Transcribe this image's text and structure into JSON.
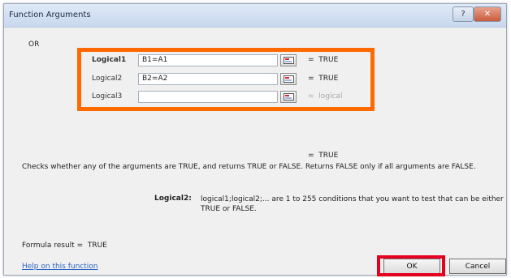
{
  "window": {
    "title": "Function Arguments"
  },
  "function_name": "OR",
  "args": [
    {
      "label": "Logical1",
      "value": "B1=A1",
      "result": "=  TRUE",
      "bold": true
    },
    {
      "label": "Logical2",
      "value": "B2=A2",
      "result": "=  TRUE",
      "bold": false
    },
    {
      "label": "Logical3",
      "value": "",
      "result": "=  logical",
      "bold": false
    }
  ],
  "summary_result": "=  TRUE",
  "description": "Checks whether any of the arguments are TRUE, and returns TRUE or FALSE. Returns FALSE only if all arguments are FALSE.",
  "arg_description": {
    "label": "Logical2:",
    "text": "logical1;logical2;... are 1 to 255 conditions that you want to test that can be either TRUE or FALSE."
  },
  "formula_result": "Formula result =  TRUE",
  "help_link": "Help on this function",
  "buttons": {
    "ok": "OK",
    "cancel": "Cancel"
  },
  "colors": {
    "highlight_orange": "#ff6a00",
    "highlight_red": "#e6001f",
    "link": "#2a62c3"
  }
}
